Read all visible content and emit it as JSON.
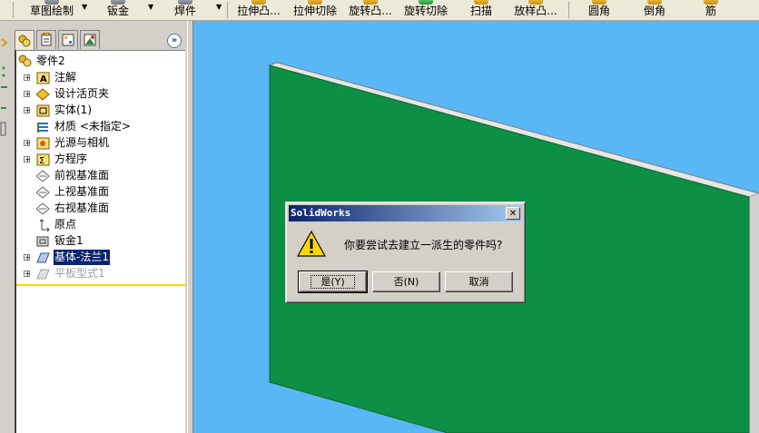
{
  "toolbar": {
    "items": [
      {
        "label": "草图绘制",
        "icon": "sketch-icon"
      },
      {
        "label": "钣金",
        "icon": "sheet-metal-icon"
      },
      {
        "label": "焊件",
        "icon": "weldments-icon"
      },
      {
        "label": "拉伸凸...",
        "icon": "extruded-boss-icon"
      },
      {
        "label": "拉伸切除",
        "icon": "extruded-cut-icon"
      },
      {
        "label": "旋转凸...",
        "icon": "revolved-boss-icon"
      },
      {
        "label": "旋转切除",
        "icon": "revolved-cut-icon"
      },
      {
        "label": "扫描",
        "icon": "sweep-icon"
      },
      {
        "label": "放样凸...",
        "icon": "loft-icon"
      },
      {
        "label": "圆角",
        "icon": "fillet-icon"
      },
      {
        "label": "倒角",
        "icon": "chamfer-icon"
      },
      {
        "label": "筋",
        "icon": "rib-icon"
      }
    ]
  },
  "feature_manager": {
    "tabs": [
      {
        "name": "feature-manager-tab",
        "icon": "feature-tree-icon"
      },
      {
        "name": "property-manager-tab",
        "icon": "property-icon"
      },
      {
        "name": "configuration-manager-tab",
        "icon": "configuration-icon"
      },
      {
        "name": "display-manager-tab",
        "icon": "display-icon"
      }
    ],
    "root_label": "零件2",
    "items": [
      {
        "label": "注解",
        "expandable": true
      },
      {
        "label": "设计活页夹",
        "expandable": true
      },
      {
        "label": "实体(1)",
        "expandable": true
      },
      {
        "label": "材质 <未指定>",
        "expandable": false
      },
      {
        "label": "光源与相机",
        "expandable": true
      },
      {
        "label": "方程序",
        "expandable": true
      },
      {
        "label": "前视基准面",
        "expandable": false
      },
      {
        "label": "上视基准面",
        "expandable": false
      },
      {
        "label": "右视基准面",
        "expandable": false
      },
      {
        "label": "原点",
        "expandable": false
      },
      {
        "label": "钣金1",
        "expandable": false
      },
      {
        "label": "基体-法兰1",
        "expandable": true,
        "selected": true
      },
      {
        "label": "平板型式1",
        "expandable": true,
        "suppressed": true
      }
    ]
  },
  "viewport": {
    "background_color": "#5ab7f5",
    "part_face_color": "#0d8f45"
  },
  "dialog": {
    "title": "SolidWorks",
    "message": "你要尝试去建立一派生的零件吗?",
    "icon": "warning-icon",
    "buttons": {
      "yes": "是(Y)",
      "no": "否(N)",
      "cancel": "取消"
    }
  }
}
